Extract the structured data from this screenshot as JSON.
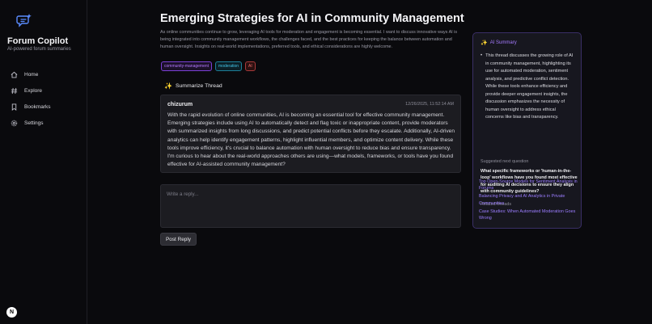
{
  "sidebar": {
    "brand_title": "Forum Copilot",
    "brand_subtitle": "AI-powered forum summaries",
    "logo_icon": "chat-sparkle-icon",
    "nav": [
      {
        "label": "Home",
        "icon": "home-icon"
      },
      {
        "label": "Explore",
        "icon": "hash-icon"
      },
      {
        "label": "Bookmarks",
        "icon": "bookmark-icon"
      },
      {
        "label": "Settings",
        "icon": "gear-icon"
      }
    ],
    "footer_badge": "N"
  },
  "thread": {
    "title": "Emerging Strategies for AI in Community Management",
    "description": "As online communities continue to grow, leveraging AI tools for moderation and engagement is becoming essential. I want to discuss innovative ways AI is being integrated into community management workflows, the challenges faced, and the best practices for keeping the balance between automation and human oversight. Insights on real-world implementations, preferred tools, and ethical considerations are highly welcome.",
    "tags": [
      "community-management",
      "moderation",
      "AI"
    ],
    "summarize_label": "Summarize Thread",
    "post": {
      "author": "chizurum",
      "timestamp": "12/26/2025, 11:52:14 AM",
      "body": "With the rapid evolution of online communities, AI is becoming an essential tool for effective community management. Emerging strategies include using AI to automatically detect and flag toxic or inappropriate content, provide moderators with summarized insights from long discussions, and predict potential conflicts before they escalate. Additionally, AI-driven analytics can help identify engagement patterns, highlight influential members, and optimize content delivery. While these tools improve efficiency, it's crucial to balance automation with human oversight to reduce bias and ensure transparency. I'm curious to hear about the real-world approaches others are using—what models, frameworks, or tools have you found effective for AI-assisted community management?"
    },
    "reply_placeholder": "Write a reply...",
    "post_reply_label": "Post Reply"
  },
  "ai_panel": {
    "title": "AI Summary",
    "summary": "This thread discusses the growing role of AI in community management, highlighting its use for automated moderation, sentiment analysis, and predictive conflict detection. While these tools enhance efficiency and provide deeper engagement insights, the discussion emphasizes the necessity of human oversight to address ethical concerns like bias and transparency.",
    "next_question_label": "Suggested next question",
    "next_question": "What specific frameworks or 'human-in-the-loop' workflows have you found most effective for auditing AI decisions to ensure they align with community guidelines?",
    "related_label": "Related threads",
    "related": [
      "Top Open-Source Models for Sentiment Analysis in Forums",
      "Balancing Privacy and AI Analytics in Private Communities",
      "Case Studies: When Automated Moderation Goes Wrong"
    ]
  },
  "colors": {
    "background": "#0a0a0d",
    "card": "#1c1c21",
    "accent": "#a57bff",
    "link": "#9b7dff"
  }
}
